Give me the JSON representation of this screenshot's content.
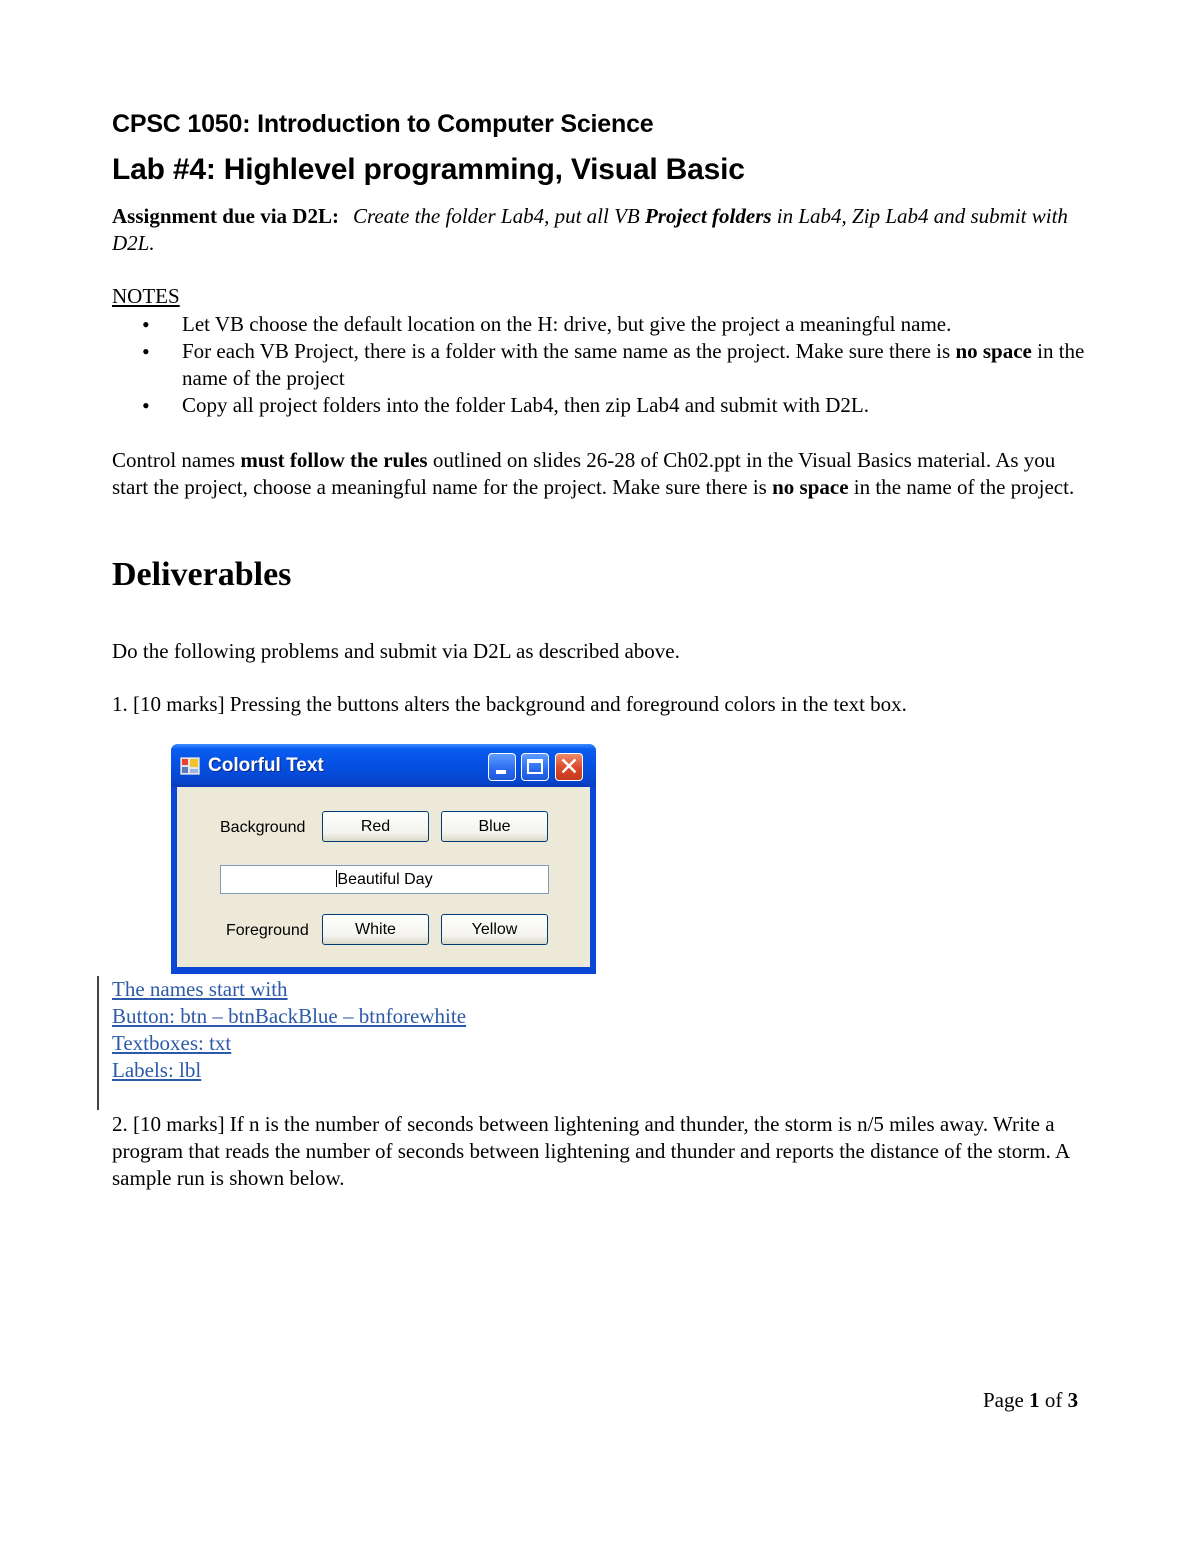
{
  "header": {
    "course_title": "CPSC 1050: Introduction to Computer Science",
    "lab_title": "Lab #4: Highlevel programming, Visual Basic"
  },
  "assignment": {
    "label": "Assignment due via D2L:",
    "text_part1": "Create the folder Lab4, put all VB ",
    "text_bold": "Project folders",
    "text_part2": " in Lab4, Zip Lab4 and submit with D2L."
  },
  "notes": {
    "heading": "NOTES ",
    "items": [
      {
        "text": "Let VB choose the default location on the H: drive, but give the project a meaningful name."
      },
      {
        "pre": "For each VB Project, there is a folder with the same name as the project. Make sure there is ",
        "bold": "no space",
        "post": " in the name of the project"
      },
      {
        "text": "Copy all project folders into the folder Lab4, then zip Lab4 and submit with D2L."
      }
    ]
  },
  "control_names": {
    "pre": "Control names ",
    "bold1": "must follow the rules",
    "mid": " outlined on slides 26-28 of Ch02.ppt in the Visual Basics material. As you start the project, choose a meaningful name for the project. Make sure there is ",
    "bold2": "no space",
    "post": " in the name of the project."
  },
  "deliverables": {
    "heading": "Deliverables",
    "intro": "Do the following problems and submit via D2L as described above.",
    "q1": "1. [10 marks] Pressing the buttons alters the background and foreground colors in the text box.",
    "q2": "2. [10 marks] If n is the number of seconds between lightening and thunder, the storm is n/5 miles away. Write a program that reads the number of seconds between lightening and thunder and reports the distance of the storm. A sample run is shown below."
  },
  "window": {
    "title": "Colorful Text",
    "icons": {
      "app": "app-form-icon",
      "minimize": "minimize-icon",
      "maximize": "maximize-icon",
      "close": "close-icon"
    },
    "close_glyph": "✕",
    "background_label": "Background",
    "foreground_label": "Foreground",
    "buttons": {
      "red": "Red",
      "blue": "Blue",
      "white": "White",
      "yellow": "Yellow"
    },
    "textbox_value": "Beautiful Day",
    "colors": {
      "titlebar": "#0550e2",
      "client": "#ece9d8",
      "close": "#d9472a"
    }
  },
  "naming_links": [
    "The names start with ",
    "Button: btn – btnBackBlue – btnforewhite",
    "Textboxes: txt",
    "Labels: lbl"
  ],
  "footer": {
    "page_word": "Page ",
    "page_current": "1",
    "of_word": " of ",
    "page_total": "3"
  },
  "colors": {
    "link": "#2c5aa8"
  }
}
